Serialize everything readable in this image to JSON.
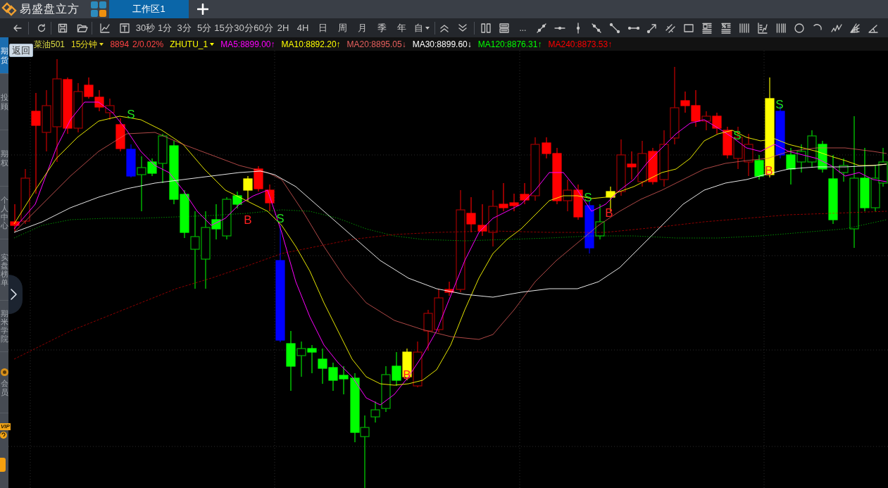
{
  "app": {
    "name": "易盛盘立方"
  },
  "tabs": [
    {
      "label": "工作区1",
      "selected": true
    }
  ],
  "toolbar": {
    "periods": [
      "30秒",
      "1分",
      "3分",
      "5分",
      "15分",
      "30分",
      "60分",
      "2H",
      "4H",
      "日",
      "周",
      "月",
      "季",
      "年"
    ],
    "custom_period": "自",
    "more_tools": "..."
  },
  "sidebar": {
    "items": [
      {
        "label": "期货",
        "selected": true
      },
      {
        "label": "投顾",
        "selected": false
      },
      {
        "label": "期权",
        "selected": false
      },
      {
        "label": "个人中心",
        "selected": false
      },
      {
        "label": "实盘榜单",
        "selected": false
      },
      {
        "label": "期米学院",
        "selected": false
      }
    ],
    "member": {
      "label": "会员"
    },
    "vip_badge": "VIP"
  },
  "back_button": "返回",
  "quote_bar": {
    "symbol": "菜油501",
    "period": "15分钟",
    "price": "8894",
    "change": "2/0.02%",
    "indicator": "ZHUTU_1",
    "averages": [
      {
        "label": "MA5:8899.00↑",
        "color": "#ff00ff"
      },
      {
        "label": "MA10:8892.20↑",
        "color": "#ffff00"
      },
      {
        "label": "MA20:8895.05↓",
        "color": "#e8605e"
      },
      {
        "label": "MA30:8899.60↓",
        "color": "#ffffff"
      },
      {
        "label": "MA120:8876.31↑",
        "color": "#00ff00"
      },
      {
        "label": "MA240:8873.53↑",
        "color": "#ff0000"
      }
    ]
  },
  "chart": {
    "signals": [
      {
        "kind": "sell",
        "label": "S"
      },
      {
        "kind": "buy",
        "label": "B"
      },
      {
        "kind": "sell",
        "label": "S"
      },
      {
        "kind": "buy",
        "label": "B"
      },
      {
        "kind": "sell",
        "label": "S"
      },
      {
        "kind": "buy",
        "label": "B"
      },
      {
        "kind": "sell",
        "label": "S"
      },
      {
        "kind": "buy",
        "label": "B"
      },
      {
        "kind": "sell",
        "label": "S"
      }
    ]
  }
}
